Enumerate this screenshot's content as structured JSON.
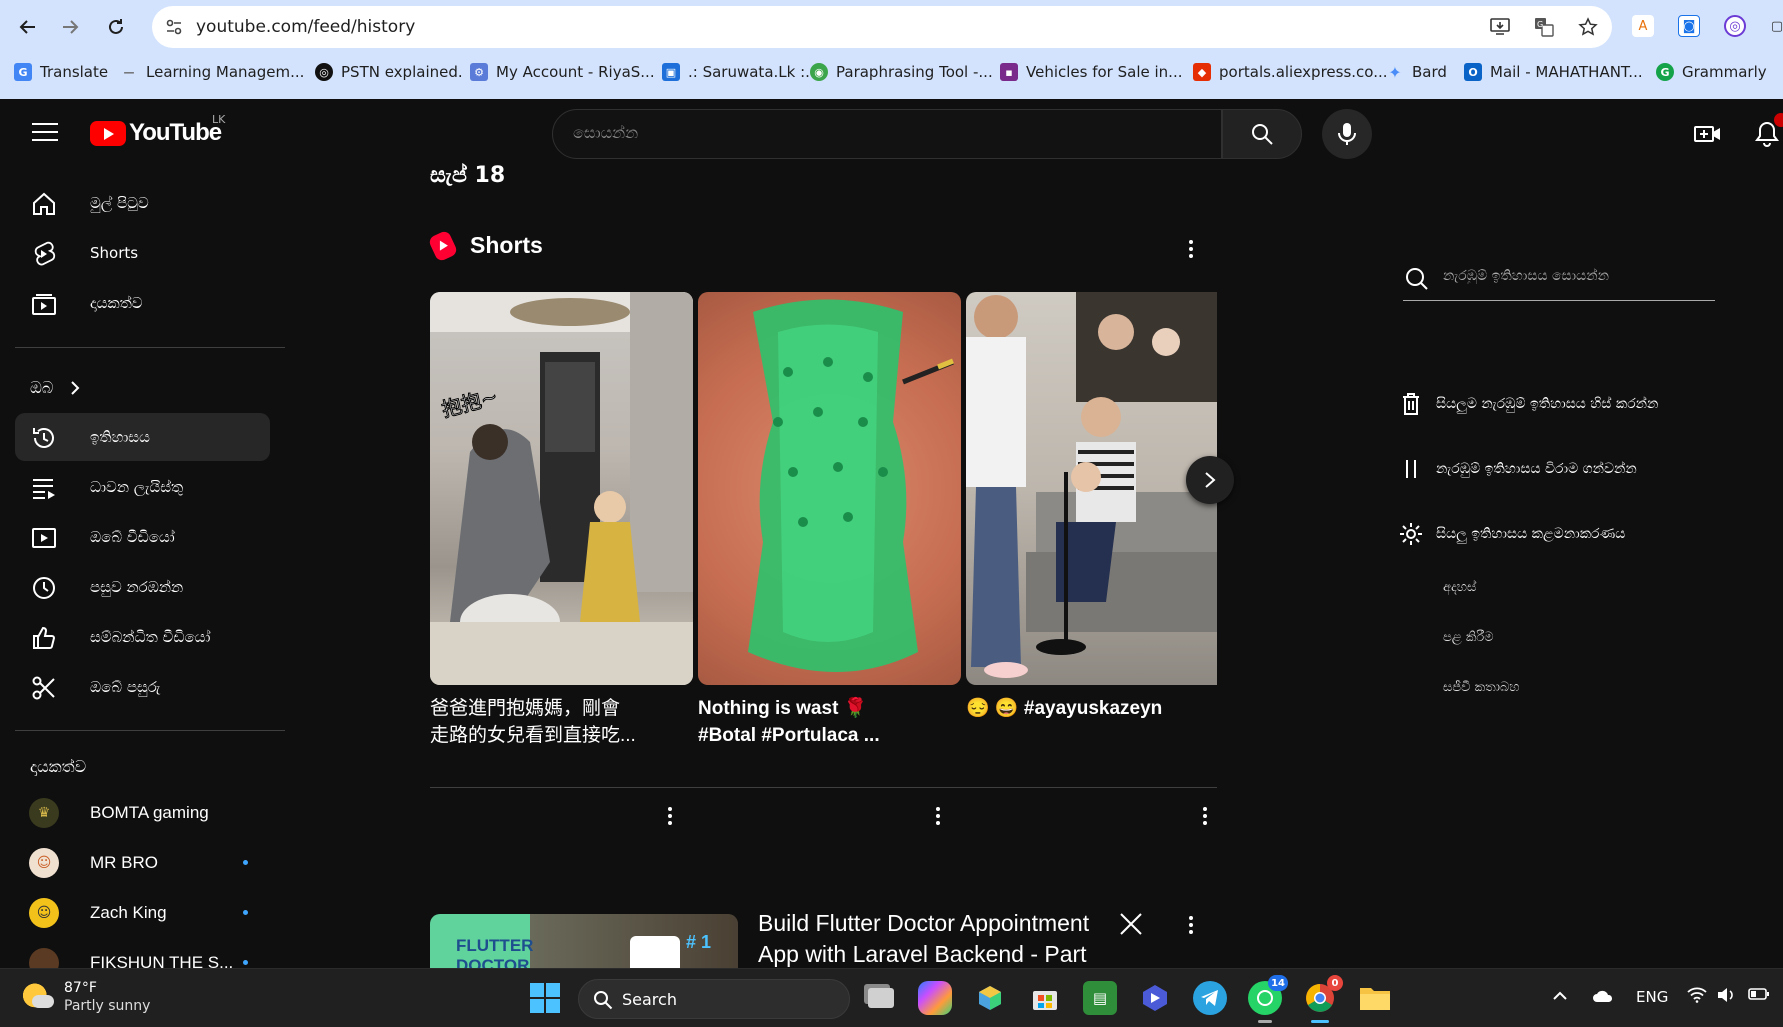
{
  "browser": {
    "url": "youtube.com/feed/history",
    "bookmarks": [
      {
        "label": "Translate",
        "color": "#4285f4",
        "glyph": "G"
      },
      {
        "label": "Learning Managem...",
        "color": "#888888",
        "glyph": "—"
      },
      {
        "label": "PSTN explained.",
        "color": "#111111",
        "glyph": "◎"
      },
      {
        "label": "My Account - RiyaS...",
        "color": "#5a7bd8",
        "glyph": "⚙"
      },
      {
        "label": ".: Saruwata.Lk :.",
        "color": "#1e6fd9",
        "glyph": "▣"
      },
      {
        "label": "Paraphrasing Tool -...",
        "color": "#3aa54a",
        "glyph": "◉"
      },
      {
        "label": "Vehicles for Sale in...",
        "color": "#7a2a8a",
        "glyph": "▪"
      },
      {
        "label": "portals.aliexpress.co...",
        "color": "#e62e04",
        "glyph": "◆"
      },
      {
        "label": "Bard",
        "color": "#4b8df8",
        "glyph": "✦"
      },
      {
        "label": "Mail - MAHATHANT...",
        "color": "#0a64c8",
        "glyph": "O"
      },
      {
        "label": "Grammarly",
        "color": "#15a34a",
        "glyph": "G"
      }
    ]
  },
  "masthead": {
    "logo_text": "YouTube",
    "country_code": "LK",
    "search_placeholder": "සොයන්න"
  },
  "sidebar": {
    "primary": [
      {
        "label": "මුල් පිටුව",
        "icon": "home-icon"
      },
      {
        "label": "Shorts",
        "icon": "shorts-icon"
      },
      {
        "label": "දායකත්ව",
        "icon": "subscriptions-icon"
      }
    ],
    "you_header": "ඔබ",
    "you_items": [
      {
        "label": "ඉතිහාසය",
        "icon": "history-icon",
        "active": true
      },
      {
        "label": "ධාවන ලැයිස්තු",
        "icon": "playlists-icon"
      },
      {
        "label": "ඔබේ වීඩියෝ",
        "icon": "your-videos-icon"
      },
      {
        "label": "පසුව නරඹන්න",
        "icon": "watch-later-icon"
      },
      {
        "label": "සම්බන්ධිත වීඩියෝ",
        "icon": "liked-videos-icon"
      },
      {
        "label": "ඔබේ පසුරු",
        "icon": "clips-icon"
      }
    ],
    "subs_header": "දායකත්ව",
    "subscriptions": [
      {
        "name": "BOMTA gaming",
        "new": false,
        "color": "#6b5a1e"
      },
      {
        "name": "MR BRO",
        "new": true,
        "color": "#c98a5a"
      },
      {
        "name": "Zach King",
        "new": true,
        "color": "#f2c21b"
      },
      {
        "name": "FIKSHUN THE S...",
        "new": true,
        "color": "#7a4a2a"
      }
    ]
  },
  "main": {
    "date_heading": "සැප් 18",
    "shorts_heading": "Shorts",
    "shorts": [
      {
        "title_line1": "爸爸進門抱媽媽，剛會",
        "title_line2": "走路的女兒看到直接吃..."
      },
      {
        "title_line1": "Nothing is wast 🌹",
        "title_line2": "#Botal #Portulaca ..."
      },
      {
        "title_line1": "😔 😄 #ayayuskazeyn",
        "title_line2": ""
      }
    ],
    "video": {
      "title_line1": "Build Flutter Doctor Appointment",
      "title_line2": "App with Laravel Backend - Part ...",
      "thumb_label": "FLUTTER",
      "thumb_label2": "DOCTOR",
      "thumb_number": "# 1"
    }
  },
  "right_panel": {
    "search_placeholder": "නැරඹුම් ඉතිහාසය සොයන්න",
    "actions": [
      {
        "label": "සියලුම නැරඹුම් ඉතිහාසය හිස් කරන්න",
        "icon": "trash-icon"
      },
      {
        "label": "නැරඹුම් ඉතිහාසය විරාම ගන්වන්න",
        "icon": "pause-icon"
      },
      {
        "label": "සියලු ඉතිහාසය කළමනාකරණය",
        "icon": "gear-icon"
      }
    ],
    "sub_links": [
      "අදහස්",
      "පළ කිරීම",
      "සජීවී කතාබහ"
    ]
  },
  "taskbar": {
    "temperature": "87°F",
    "weather": "Partly sunny",
    "search_label": "Search",
    "whatsapp_badge": "14",
    "chrome_badge": "0",
    "language": "ENG"
  }
}
